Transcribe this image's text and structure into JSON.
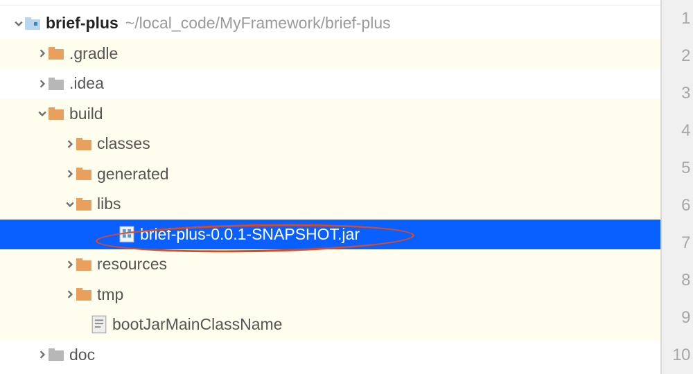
{
  "tree": {
    "root": {
      "name": "brief-plus",
      "path": "~/local_code/MyFramework/brief-plus",
      "expanded": true,
      "icon": "module-folder-icon",
      "children": [
        {
          "name": ".gradle",
          "icon": "folder-icon",
          "color": "orange",
          "expanded": false,
          "highlighted": true
        },
        {
          "name": ".idea",
          "icon": "folder-icon",
          "color": "grey",
          "expanded": false
        },
        {
          "name": "build",
          "icon": "folder-icon",
          "color": "orange",
          "expanded": true,
          "highlighted": true,
          "children": [
            {
              "name": "classes",
              "icon": "folder-icon",
              "color": "orange",
              "expanded": false,
              "highlighted": true
            },
            {
              "name": "generated",
              "icon": "folder-icon",
              "color": "orange",
              "expanded": false,
              "highlighted": true
            },
            {
              "name": "libs",
              "icon": "folder-icon",
              "color": "orange",
              "expanded": true,
              "highlighted": true,
              "children": [
                {
                  "name": "brief-plus-0.0.1-SNAPSHOT.jar",
                  "icon": "jar-file-icon",
                  "selected": true,
                  "annotated": true
                }
              ]
            },
            {
              "name": "resources",
              "icon": "folder-icon",
              "color": "orange",
              "expanded": false,
              "highlighted": true
            },
            {
              "name": "tmp",
              "icon": "folder-icon",
              "color": "orange",
              "expanded": false,
              "highlighted": true
            },
            {
              "name": "bootJarMainClassName",
              "icon": "text-file-icon",
              "highlighted": true
            }
          ]
        },
        {
          "name": "doc",
          "icon": "folder-icon",
          "color": "grey",
          "expanded": false
        }
      ]
    }
  },
  "gutter": [
    "1",
    "2",
    "3",
    "4",
    "5",
    "6",
    "7",
    "8",
    "9",
    "10"
  ],
  "colors": {
    "selection": "#0a60ff",
    "highlight_row": "#fffded",
    "folder_orange": "#e8a05c",
    "folder_grey": "#b7b7b7",
    "annotation": "#d84a23"
  }
}
